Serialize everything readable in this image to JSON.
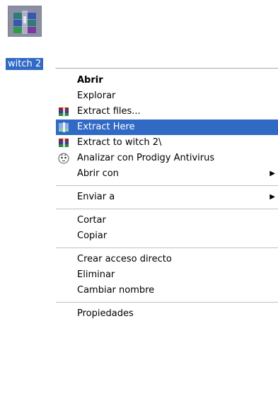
{
  "desktop_icon": {
    "label": "witch 2",
    "icon": "winrar-archive-icon"
  },
  "menu": {
    "open": "Abrir",
    "explore": "Explorar",
    "extract_files": "Extract files...",
    "extract_here": "Extract Here",
    "extract_to": "Extract to witch 2\\",
    "scan_antivirus": "Analizar con Prodigy Antivirus",
    "open_with": "Abrir con",
    "send_to": "Enviar a",
    "cut": "Cortar",
    "copy": "Copiar",
    "create_shortcut": "Crear acceso directo",
    "delete": "Eliminar",
    "rename": "Cambiar nombre",
    "properties": "Propiedades",
    "submenu_arrow": "▶"
  },
  "colors": {
    "highlight": "#316ac5",
    "highlight_text": "#ffffff",
    "separator": "#c0c0c0"
  }
}
